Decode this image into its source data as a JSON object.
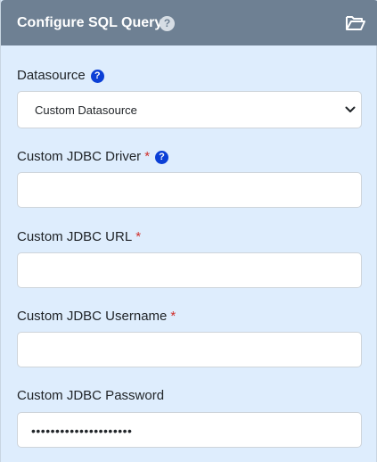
{
  "header": {
    "title": "Configure SQL Query",
    "help_glyph": "?",
    "folder_icon": "folder-open-icon"
  },
  "datasource": {
    "label": "Datasource",
    "help_glyph": "?",
    "selected": "Custom Datasource"
  },
  "fields": {
    "driver": {
      "label": "Custom JDBC Driver",
      "required_mark": "*",
      "help_glyph": "?",
      "value": ""
    },
    "url": {
      "label": "Custom JDBC URL",
      "required_mark": "*",
      "value": ""
    },
    "username": {
      "label": "Custom JDBC Username",
      "required_mark": "*",
      "value": ""
    },
    "password": {
      "label": "Custom JDBC Password",
      "masked_value": "•••••••••••••••••••••"
    }
  },
  "colors": {
    "header_bg": "#6e8093",
    "panel_bg": "#deedfd",
    "required": "#d0312d",
    "help_blue": "#0b3fd6"
  }
}
